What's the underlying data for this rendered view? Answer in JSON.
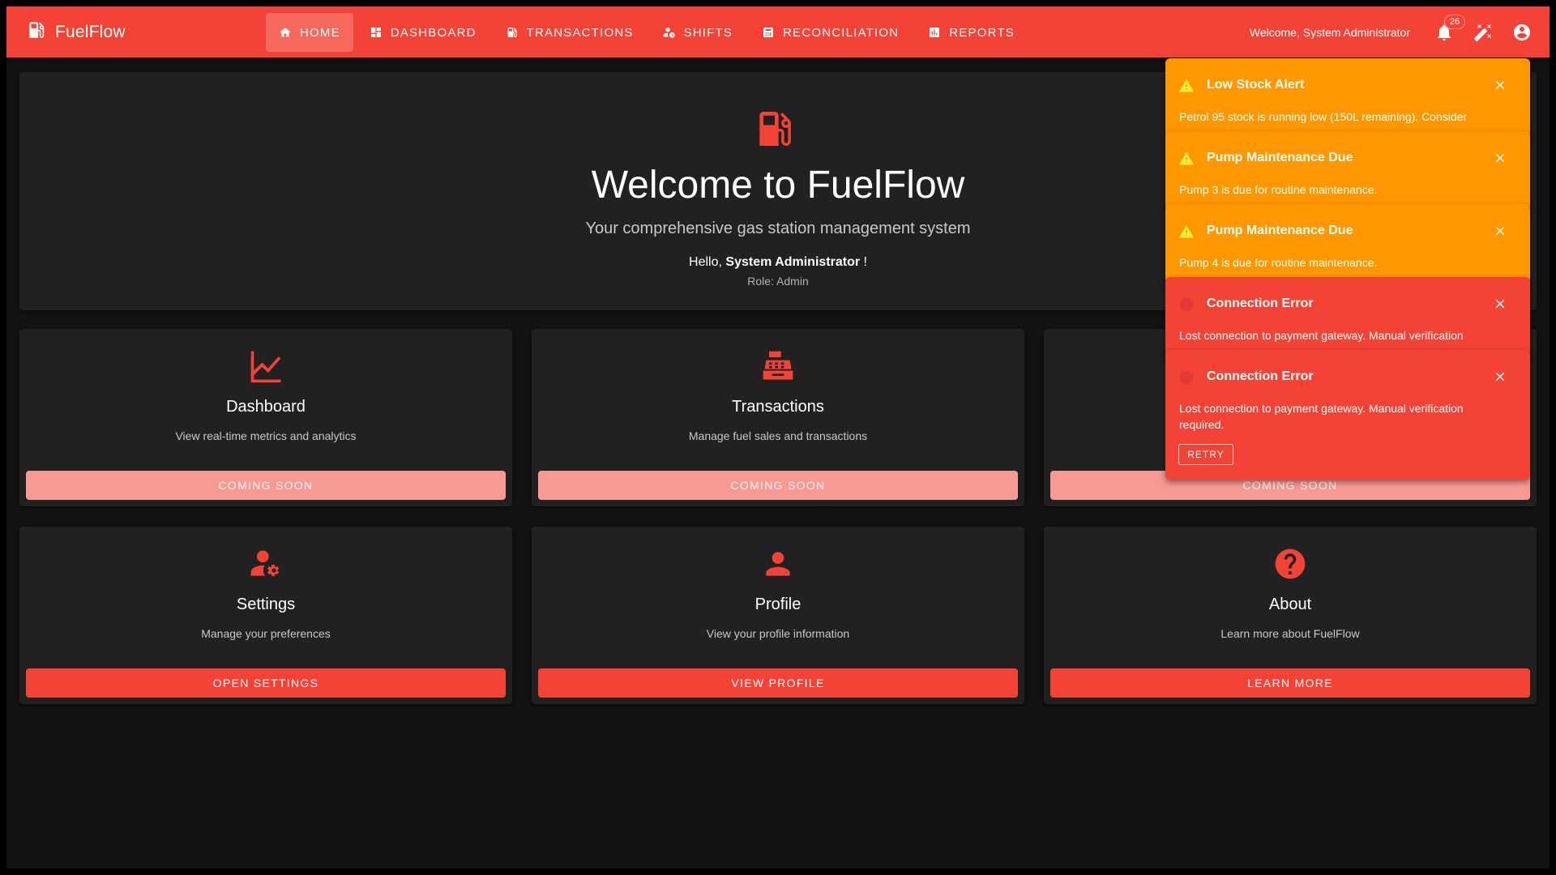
{
  "app": {
    "name": "FuelFlow",
    "accent": "#f44336",
    "warning": "#ff9800"
  },
  "nav": {
    "items": [
      {
        "label": "HOME",
        "icon": "home-icon",
        "active": true
      },
      {
        "label": "DASHBOARD",
        "icon": "dashboard-icon"
      },
      {
        "label": "TRANSACTIONS",
        "icon": "fuel-pump-icon"
      },
      {
        "label": "SHIFTS",
        "icon": "person-clock-icon"
      },
      {
        "label": "RECONCILIATION",
        "icon": "calculator-icon"
      },
      {
        "label": "REPORTS",
        "icon": "bar-chart-icon"
      }
    ]
  },
  "header": {
    "welcome": "Welcome, System Administrator",
    "notification_count": "26"
  },
  "hero": {
    "title": "Welcome to FuelFlow",
    "subtitle": "Your comprehensive gas station management system",
    "hello_prefix": "Hello,",
    "user_name": "System Administrator",
    "hello_suffix": "!",
    "role": "Role: Admin"
  },
  "cards": [
    {
      "icon": "line-chart-icon",
      "title": "Dashboard",
      "desc": "View real-time metrics and analytics",
      "button": "COMING SOON"
    },
    {
      "icon": "cash-register-icon",
      "title": "Transactions",
      "desc": "Manage fuel sales and transactions",
      "button": "COMING SOON"
    },
    {
      "button": "COMING SOON"
    },
    {
      "icon": "user-gear-icon",
      "title": "Settings",
      "desc": "Manage your preferences",
      "button": "OPEN SETTINGS"
    },
    {
      "icon": "person-icon",
      "title": "Profile",
      "desc": "View your profile information",
      "button": "VIEW PROFILE"
    },
    {
      "icon": "help-circle-icon",
      "title": "About",
      "desc": "Learn more about FuelFlow",
      "button": "LEARN MORE"
    }
  ],
  "notifications": [
    {
      "type": "warning",
      "title": "Low Stock Alert",
      "message": "Petrol 95 stock is running low (150L remaining). Consider"
    },
    {
      "type": "warning",
      "title": "Pump Maintenance Due",
      "message": "Pump 3 is due for routine maintenance."
    },
    {
      "type": "warning",
      "title": "Pump Maintenance Due",
      "message": "Pump 4 is due for routine maintenance."
    },
    {
      "type": "error",
      "title": "Connection Error",
      "message": "Lost connection to payment gateway. Manual verification"
    },
    {
      "type": "error",
      "title": "Connection Error",
      "message": "Lost connection to payment gateway. Manual verification required.",
      "action": "RETRY"
    }
  ]
}
